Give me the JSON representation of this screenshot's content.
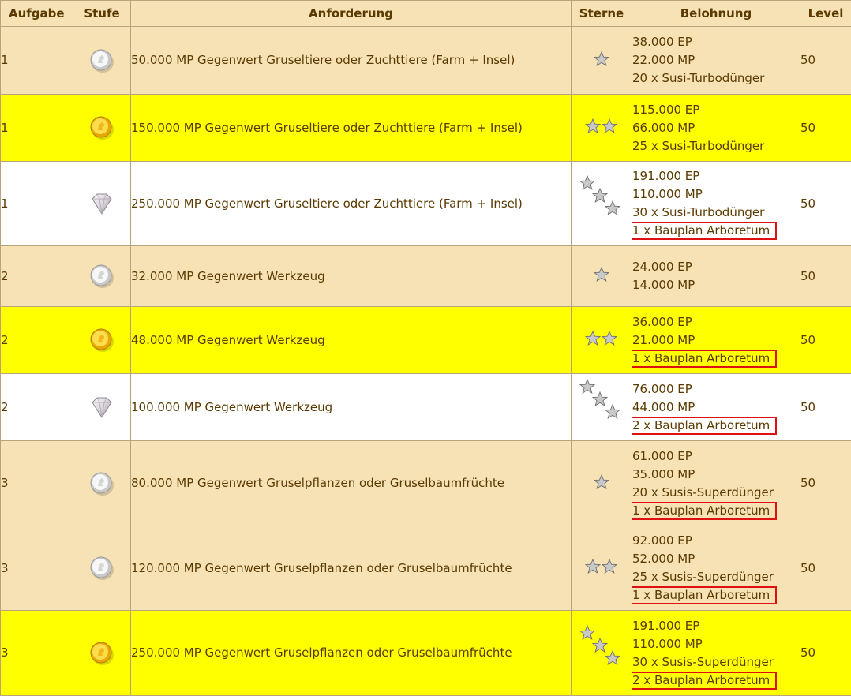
{
  "headers": [
    "Aufgabe",
    "Stufe",
    "Anforderung",
    "Sterne",
    "Belohnung",
    "Level"
  ],
  "rows": [
    {
      "aufgabe": "1",
      "stufe": "silver",
      "anforderung": "50.000 MP Gegenwert Gruseltiere oder Zuchttiere (Farm + Insel)",
      "sterne": 1,
      "belohnung": [
        {
          "text": "38.000 EP",
          "boxed": false
        },
        {
          "text": "22.000 MP",
          "boxed": false
        },
        {
          "text": "20 x Susi-Turbodünger",
          "boxed": false
        }
      ],
      "level": "50",
      "color": "beige"
    },
    {
      "aufgabe": "1",
      "stufe": "gold",
      "anforderung": "150.000 MP Gegenwert Gruseltiere oder Zuchttiere (Farm + Insel)",
      "sterne": 2,
      "belohnung": [
        {
          "text": "115.000 EP",
          "boxed": false
        },
        {
          "text": "66.000 MP",
          "boxed": false
        },
        {
          "text": "25 x Susi-Turbodünger",
          "boxed": false
        }
      ],
      "level": "50",
      "color": "yellow"
    },
    {
      "aufgabe": "1",
      "stufe": "diamond",
      "anforderung": "250.000 MP Gegenwert Gruseltiere oder Zuchttiere (Farm + Insel)",
      "sterne": 3,
      "belohnung": [
        {
          "text": "191.000 EP",
          "boxed": false
        },
        {
          "text": "110.000 MP",
          "boxed": false
        },
        {
          "text": "30 x Susi-Turbodünger",
          "boxed": false
        },
        {
          "text": "1 x Bauplan Arboretum",
          "boxed": true
        }
      ],
      "level": "50",
      "color": "white"
    },
    {
      "aufgabe": "2",
      "stufe": "silver",
      "anforderung": "32.000 MP Gegenwert Werkzeug",
      "sterne": 1,
      "belohnung": [
        {
          "text": "24.000 EP",
          "boxed": false
        },
        {
          "text": "14.000 MP",
          "boxed": false
        }
      ],
      "level": "50",
      "color": "beige"
    },
    {
      "aufgabe": "2",
      "stufe": "gold",
      "anforderung": "48.000 MP Gegenwert Werkzeug",
      "sterne": 2,
      "belohnung": [
        {
          "text": "36.000 EP",
          "boxed": false
        },
        {
          "text": "21.000 MP",
          "boxed": false
        },
        {
          "text": "1 x Bauplan Arboretum",
          "boxed": true
        }
      ],
      "level": "50",
      "color": "yellow"
    },
    {
      "aufgabe": "2",
      "stufe": "diamond",
      "anforderung": "100.000 MP Gegenwert Werkzeug",
      "sterne": 3,
      "belohnung": [
        {
          "text": "76.000 EP",
          "boxed": false
        },
        {
          "text": "44.000 MP",
          "boxed": false
        },
        {
          "text": "2 x Bauplan Arboretum",
          "boxed": true
        }
      ],
      "level": "50",
      "color": "white"
    },
    {
      "aufgabe": "3",
      "stufe": "silver",
      "anforderung": "80.000 MP Gegenwert Gruselpflanzen oder Gruselbaumfrüchte",
      "sterne": 1,
      "belohnung": [
        {
          "text": "61.000 EP",
          "boxed": false
        },
        {
          "text": "35.000 MP",
          "boxed": false
        },
        {
          "text": "20 x Susis-Superdünger",
          "boxed": false
        },
        {
          "text": "1 x Bauplan Arboretum",
          "boxed": true
        }
      ],
      "level": "50",
      "color": "beige"
    },
    {
      "aufgabe": "3",
      "stufe": "silver",
      "anforderung": "120.000 MP Gegenwert Gruselpflanzen oder Gruselbaumfrüchte",
      "sterne": 2,
      "belohnung": [
        {
          "text": "92.000 EP",
          "boxed": false
        },
        {
          "text": "52.000 MP",
          "boxed": false
        },
        {
          "text": "25 x Susis-Superdünger",
          "boxed": false
        },
        {
          "text": "1 x Bauplan Arboretum",
          "boxed": true
        }
      ],
      "level": "50",
      "color": "beige"
    },
    {
      "aufgabe": "3",
      "stufe": "gold",
      "anforderung": "250.000 MP Gegenwert Gruselpflanzen oder Gruselbaumfrüchte",
      "sterne": 3,
      "belohnung": [
        {
          "text": "191.000 EP",
          "boxed": false
        },
        {
          "text": "110.000 MP",
          "boxed": false
        },
        {
          "text": "30 x Susis-Superdünger",
          "boxed": false
        },
        {
          "text": "2 x Bauplan Arboretum",
          "boxed": true
        }
      ],
      "level": "50",
      "color": "yellow"
    }
  ],
  "icons": {
    "silver": "silver-coin-icon",
    "gold": "gold-coin-icon",
    "diamond": "diamond-icon",
    "star": "star-icon"
  },
  "colors": {
    "beige": "#f7e2b5",
    "yellow": "#ffff00",
    "white": "#ffffff",
    "border": "#b8a37a",
    "text": "#5a3a00",
    "highlight": "#dd1111"
  }
}
